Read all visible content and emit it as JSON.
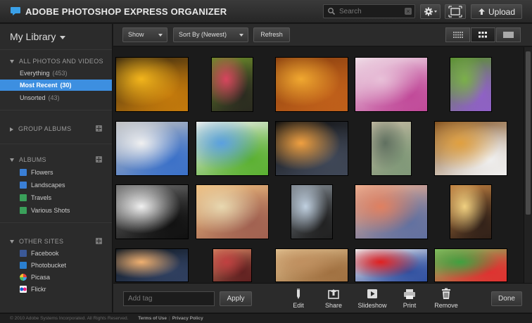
{
  "app": {
    "title": "ADOBE PHOTOSHOP EXPRESS ORGANIZER"
  },
  "header": {
    "search_placeholder": "Search",
    "upload_label": "Upload"
  },
  "sidebar": {
    "library_title": "My Library",
    "all_photos": {
      "heading": "ALL PHOTOS AND VIDEOS",
      "items": [
        {
          "label": "Everything",
          "count": "(453)"
        },
        {
          "label": "Most Recent",
          "count": "(30)",
          "active": true
        },
        {
          "label": "Unsorted",
          "count": "(43)"
        }
      ]
    },
    "group_albums": {
      "heading": "GROUP ALBUMS"
    },
    "albums": {
      "heading": "ALBUMS",
      "items": [
        {
          "label": "Flowers",
          "icon": "album-icon",
          "color": "#3a7fd6"
        },
        {
          "label": "Landscapes",
          "icon": "album-icon",
          "color": "#3a7fd6"
        },
        {
          "label": "Travels",
          "icon": "slideshow-album-icon",
          "color": "#3aa05a"
        },
        {
          "label": "Various Shots",
          "icon": "slideshow-album-icon",
          "color": "#3aa05a"
        }
      ]
    },
    "other_sites": {
      "heading": "OTHER SITES",
      "items": [
        {
          "label": "Facebook",
          "icon": "facebook-icon",
          "color": "#3b5998"
        },
        {
          "label": "Photobucket",
          "icon": "photobucket-icon",
          "color": "#2a7fd0"
        },
        {
          "label": "Picasa",
          "icon": "picasa-icon",
          "color": "#e8e8e8"
        },
        {
          "label": "Flickr",
          "icon": "flickr-icon",
          "color": "#ffffff"
        }
      ]
    }
  },
  "toolbar": {
    "show_label": "Show",
    "sort_label": "Sort By (Newest)",
    "refresh_label": "Refresh"
  },
  "photos": [
    {
      "name": "yellow-flower",
      "colors": [
        "#f2b51c",
        "#c47a0c",
        "#3a2a10"
      ]
    },
    {
      "name": "tulips",
      "colors": [
        "#d8455e",
        "#2a2a20",
        "#6b8a2a"
      ]
    },
    {
      "name": "umbrella",
      "colors": [
        "#f0a830",
        "#c0601a",
        "#8a4010"
      ]
    },
    {
      "name": "pink-orchid",
      "colors": [
        "#e8c0d8",
        "#c04898",
        "#f0e0e8"
      ]
    },
    {
      "name": "water-lily",
      "colors": [
        "#7ab048",
        "#9060c8",
        "#5a9030"
      ]
    },
    {
      "name": "arch-sky",
      "colors": [
        "#f0f0f0",
        "#3a70c8",
        "#c0c0c0"
      ]
    },
    {
      "name": "white-church",
      "colors": [
        "#5aa0e0",
        "#5ab030",
        "#f0f0f0"
      ]
    },
    {
      "name": "pagoda-sunset",
      "colors": [
        "#f0a040",
        "#404858",
        "#101010"
      ]
    },
    {
      "name": "green-doors",
      "colors": [
        "#607060",
        "#809878",
        "#c0b8a0"
      ]
    },
    {
      "name": "market-man",
      "colors": [
        "#e0a040",
        "#f0f0f0",
        "#805020"
      ]
    },
    {
      "name": "fisherman",
      "colors": [
        "#f0f0f0",
        "#101010",
        "#707070"
      ]
    },
    {
      "name": "alley-houses",
      "colors": [
        "#e8d8b0",
        "#a06050",
        "#f0c080"
      ]
    },
    {
      "name": "stupa-arch",
      "colors": [
        "#c0d0e0",
        "#202020",
        "#808890"
      ]
    },
    {
      "name": "cloudy-sky",
      "colors": [
        "#e08060",
        "#6070a0",
        "#f0b090"
      ]
    },
    {
      "name": "window-light",
      "colors": [
        "#f0d080",
        "#302018",
        "#c08040"
      ]
    },
    {
      "name": "dusk-silhouette",
      "colors": [
        "#f0b070",
        "#304060",
        "#101820"
      ]
    },
    {
      "name": "basket-hands",
      "colors": [
        "#c04040",
        "#602020",
        "#d08060"
      ]
    },
    {
      "name": "pottery-hands",
      "colors": [
        "#c09060",
        "#a07040",
        "#e0c090"
      ]
    },
    {
      "name": "red-dancers",
      "colors": [
        "#e02020",
        "#3050a0",
        "#f0f0f0"
      ]
    },
    {
      "name": "green-red-field",
      "colors": [
        "#40a040",
        "#e03030",
        "#80c060"
      ]
    }
  ],
  "bottom": {
    "tag_placeholder": "Add tag",
    "apply_label": "Apply",
    "actions": [
      {
        "label": "Edit",
        "icon": "pencil-icon"
      },
      {
        "label": "Share",
        "icon": "share-icon"
      },
      {
        "label": "Slideshow",
        "icon": "play-icon"
      },
      {
        "label": "Print",
        "icon": "printer-icon"
      },
      {
        "label": "Remove",
        "icon": "trash-icon"
      }
    ],
    "done_label": "Done"
  },
  "footer": {
    "copyright": "© 2010 Adobe Systems Incorporated. All Rights Reserved.",
    "terms": "Terms of Use",
    "privacy": "Privacy Policy"
  }
}
